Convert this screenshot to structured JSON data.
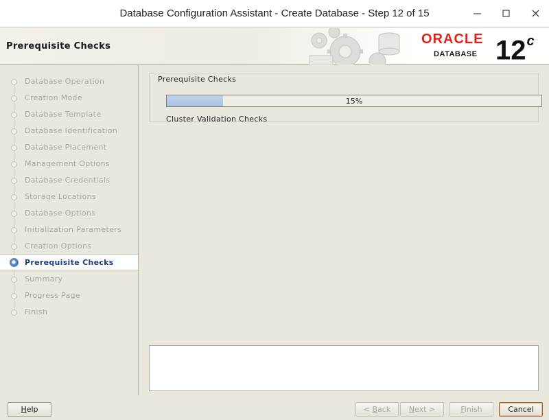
{
  "window": {
    "title": "Database Configuration Assistant - Create Database - Step 12 of 15",
    "buttons": [
      "minimize-icon",
      "maximize-icon",
      "close-icon"
    ]
  },
  "header": {
    "title": "Prerequisite Checks",
    "brand": {
      "name": "ORACLE",
      "product": "DATABASE",
      "version": "12",
      "version_suffix": "c",
      "color": "#e2231a"
    }
  },
  "sidebar": {
    "steps": [
      {
        "label": "Database Operation",
        "state": "done"
      },
      {
        "label": "Creation Mode",
        "state": "done"
      },
      {
        "label": "Database Template",
        "state": "done"
      },
      {
        "label": "Database Identification",
        "state": "done"
      },
      {
        "label": "Database Placement",
        "state": "done"
      },
      {
        "label": "Management Options",
        "state": "done"
      },
      {
        "label": "Database Credentials",
        "state": "done"
      },
      {
        "label": "Storage Locations",
        "state": "done"
      },
      {
        "label": "Database Options",
        "state": "done"
      },
      {
        "label": "Initialization Parameters",
        "state": "done"
      },
      {
        "label": "Creation Options",
        "state": "done"
      },
      {
        "label": "Prerequisite Checks",
        "state": "current"
      },
      {
        "label": "Summary",
        "state": "pending"
      },
      {
        "label": "Progress Page",
        "state": "pending"
      },
      {
        "label": "Finish",
        "state": "pending"
      }
    ]
  },
  "main": {
    "group_title": "Prerequisite Checks",
    "progress": {
      "percent": 15,
      "label": "15%"
    },
    "status": "Cluster Validation Checks",
    "details": ""
  },
  "footer": {
    "help": {
      "prefix": "",
      "mnemonic": "H",
      "rest": "elp"
    },
    "back": {
      "prefix": "< ",
      "mnemonic": "B",
      "rest": "ack"
    },
    "next": {
      "prefix": "",
      "mnemonic": "N",
      "rest": "ext >"
    },
    "finish": {
      "prefix": "",
      "mnemonic": "F",
      "rest": "inish"
    },
    "cancel": {
      "prefix": "",
      "mnemonic": "",
      "rest": "Cancel"
    }
  }
}
